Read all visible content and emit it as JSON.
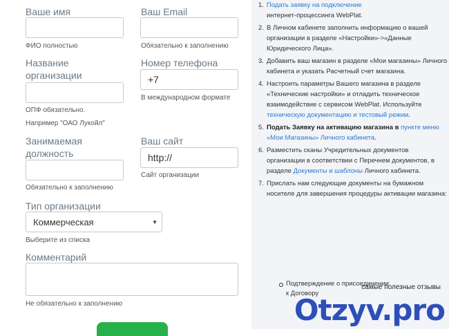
{
  "form": {
    "name_label": "Ваше имя",
    "name_hint": "ФИО полностью",
    "email_label": "Ваш Email",
    "email_hint": "Обязательно к заполнению",
    "org_label_1": "Название",
    "org_label_2": "организации",
    "org_hint_1": "ОПФ обязательно.",
    "org_hint_2": "Например \"ОАО Лукойл\"",
    "phone_label": "Номер телефона",
    "phone_value": "+7",
    "phone_hint": "В международном формате",
    "position_label_1": "Занимаемая",
    "position_label_2": "должность",
    "position_hint": "Обязательно к заполнению",
    "site_label": "Ваш сайт",
    "site_value": "http://",
    "site_hint": "Сайт организации",
    "orgtype_label": "Тип организации",
    "orgtype_value": "Коммерческая",
    "orgtype_hint": "Выберите из списка",
    "comment_label": "Комментарий",
    "comment_hint": "Не обязательно к заполнению"
  },
  "steps": {
    "s1_a": "Подать заявку на подключение",
    "s1_b": "интернет-процессинга WebPlat.",
    "s2": "В Личном кабинете заполнить информацию о вашей организации в разделе «Настройки»->«Данные Юридического Лица».",
    "s3": "Добавить ваш магазин в разделе «Мои магазины» Личного кабинета и указать Расчетный счет магазина.",
    "s4_a": "Настроить параметры Вашего магазина в разделе «Технические настройки» и отладить техническое взаимодействие с сервисом WebPlat. Используйте",
    "s4_link": "техническую документацию и тестовый режим",
    "s4_end": ".",
    "s5_a": "Подать Заявку на активацию магазина в",
    "s5_link": "пункте меню «Мои Магазины» Личного кабинета",
    "s5_end": ".",
    "s6_a": "Разместить сканы Учредительных документов организации в соответствии с Перечнем документов, в разделе",
    "s6_link": "Документы и шаблоны",
    "s6_end": "Личного кабинета.",
    "s7": "Прислать нам следующие документы на бумажном носителе для завершения процедуры активации магазина:",
    "sub1": "Подтверждение о присоединении к Договору"
  },
  "watermark": {
    "caption": "самые полезные отзывы",
    "logo": "Otzyv.pro"
  }
}
